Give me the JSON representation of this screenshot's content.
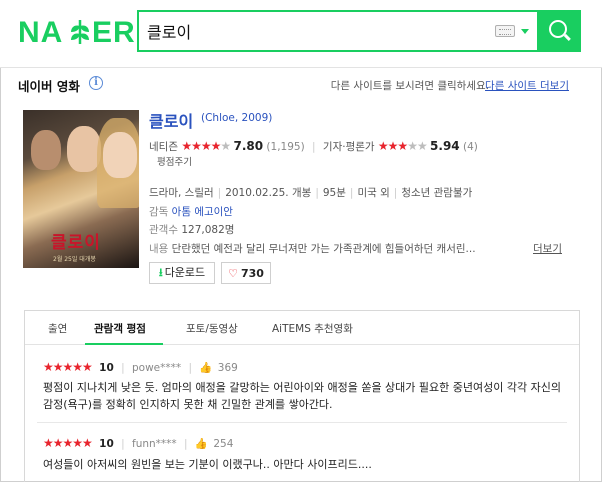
{
  "header": {
    "logo": "NAVER",
    "search_value": "클로이",
    "search_button": "search"
  },
  "section": {
    "title": "네이버 영화",
    "notice": "다른 사이트를 보시려면 클릭하세요.",
    "other_sites_link": "다른 사이트 더보기"
  },
  "poster": {
    "title": "클로이",
    "date_text": "2월 25일 대개봉"
  },
  "movie": {
    "title": "클로이",
    "original": "(Chloe, 2009)",
    "netizen_label": "네티즌",
    "netizen_stars": "★★★★",
    "netizen_stars_off": "★",
    "netizen_score": "7.80",
    "netizen_count": "(1,195)",
    "critic_label": "기자·평론가",
    "critic_stars": "★★★",
    "critic_stars_off": "★★",
    "critic_score": "5.94",
    "critic_count": "(4)",
    "rate_link": "평점주기",
    "genre": "드라마, 스릴러",
    "release": "2010.02.25. 개봉",
    "runtime": "95분",
    "country": "미국 외",
    "rating": "청소년 관람불가",
    "director_label": "감독",
    "director": "아톰 에고이안",
    "audience_label": "관객수",
    "audience": "127,082명",
    "plot_label": "내용",
    "plot": "단란했던 예전과 달리 무너져만 가는 가족관계에 힘들어하던 캐서린...",
    "more": "더보기",
    "download_label": "다운로드",
    "likes": "730"
  },
  "tabs": [
    "출연",
    "관람객 평점",
    "포토/동영상",
    "AiTEMS 추천영화"
  ],
  "reviews": [
    {
      "stars": "★★★★★",
      "score": "10",
      "user": "powe****",
      "likes": "369",
      "text": "평점이 지나치게 낮은 듯. 엄마의 애정을 갈망하는 어린아이와 애정을 쏟을 상대가 필요한 중년여성이 각각 자신의 감정(욕구)를 정확히 인지하지 못한 채 긴밀한 관계를 쌓아간다."
    },
    {
      "stars": "★★★★★",
      "score": "10",
      "user": "funn****",
      "likes": "254",
      "text": "여성들이 아저씨의 원빈을 보는 기분이 이랬구나.. 아만다 사이프리드...."
    }
  ],
  "colors": {
    "brand": "#19ce60",
    "star": "#e8242d",
    "link": "#2a52be"
  }
}
